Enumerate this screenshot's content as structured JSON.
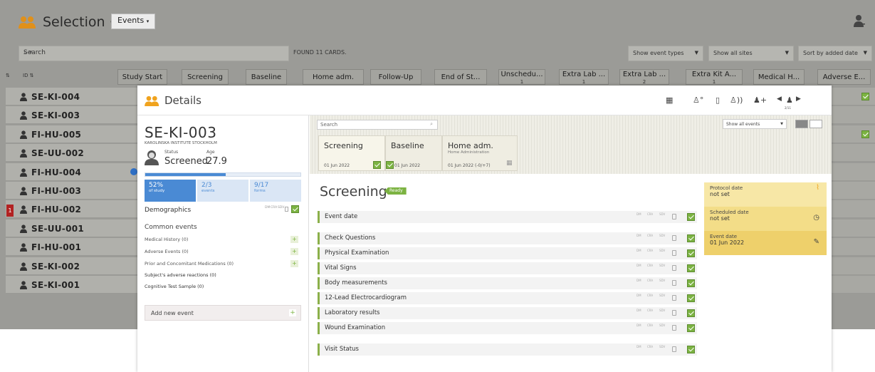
{
  "app": {
    "title": "Selection",
    "title_sep": "·",
    "events_button": "Events",
    "search_placeholder": "Search",
    "found": "FOUND 11 CARDS.",
    "filters": [
      "Show event types",
      "Show all sites",
      "Sort by added date"
    ],
    "col_sort": "⇅",
    "col_id": "ID ⇅"
  },
  "columns": [
    {
      "label": "Study Start",
      "sub": ""
    },
    {
      "label": "Screening",
      "sub": ""
    },
    {
      "label": "Baseline",
      "sub": ""
    },
    {
      "label": "Home adm.",
      "sub": ""
    },
    {
      "label": "Follow-Up",
      "sub": ""
    },
    {
      "label": "End of St...",
      "sub": ""
    },
    {
      "label": "Unschedu...",
      "sub": "1"
    },
    {
      "label": "Extra Lab ...",
      "sub": "1"
    },
    {
      "label": "Extra Lab ...",
      "sub": "2"
    },
    {
      "label": "Extra Kit A...",
      "sub": "1"
    },
    {
      "label": "Medical H...",
      "sub": ""
    },
    {
      "label": "Adverse E...",
      "sub": ""
    }
  ],
  "subjects": [
    "SE-KI-004",
    "SE-KI-003",
    "FI-HU-005",
    "SE-UU-002",
    "FI-HU-004",
    "FI-HU-003",
    "FI-HU-002",
    "SE-UU-001",
    "FI-HU-001",
    "SE-KI-002",
    "SE-KI-001"
  ],
  "row_flag": "1",
  "modal": {
    "title": "Details",
    "nav_count": "2/11",
    "subject_id": "SE-KI-003",
    "institution": "KAROLINSKA INSTITUTE STOCKHOLM",
    "status_label": "Status",
    "status_value": "Screened",
    "age_label": "Age",
    "age_value": "27.9",
    "progress": 0.52,
    "stats": [
      {
        "value": "52%",
        "label": "of study"
      },
      {
        "value": "2/3",
        "label": "events"
      },
      {
        "value": "9/17",
        "label": "forms"
      }
    ],
    "demographics": "Demographics",
    "mini_labels": [
      "DM",
      "CRA",
      "SDV"
    ],
    "common_events": "Common events",
    "events": [
      "Medical History (0)",
      "Adverse Events (0)",
      "Prior and Concomitant Medications (0)",
      "Subject's adverse reactions (0)",
      "Cognitive Test Sample (0)"
    ],
    "add_event": "Add new event",
    "search_placeholder": "Search",
    "show_all_events": "Show all events",
    "cards": [
      {
        "name": "Screening",
        "sub": "",
        "date": "01 Jun 2022"
      },
      {
        "name": "Baseline",
        "sub": "",
        "date": "01 Jun 2022"
      },
      {
        "name": "Home adm.",
        "sub": "Home Administration",
        "date": "01 Jun 2022 (-0/+7)"
      }
    ],
    "section_title": "Screening",
    "ready": "Ready",
    "forms": [
      "Event date",
      "Check Questions",
      "Physical Examination",
      "Vital Signs",
      "Body measurements",
      "12-Lead Electrocardiogram",
      "Laboratory results",
      "Wound Examination",
      "Visit Status"
    ],
    "dates": [
      {
        "label": "Protocol date",
        "value": "not set"
      },
      {
        "label": "Scheduled date",
        "value": "not set"
      },
      {
        "label": "Event date",
        "value": "01 Jun 2022"
      }
    ]
  },
  "colors": {
    "accent_green": "#7cb342",
    "progress_blue": "#4a8ad4",
    "people_orange": "#f0a31e",
    "date_yellow": "#f7e7a6"
  }
}
